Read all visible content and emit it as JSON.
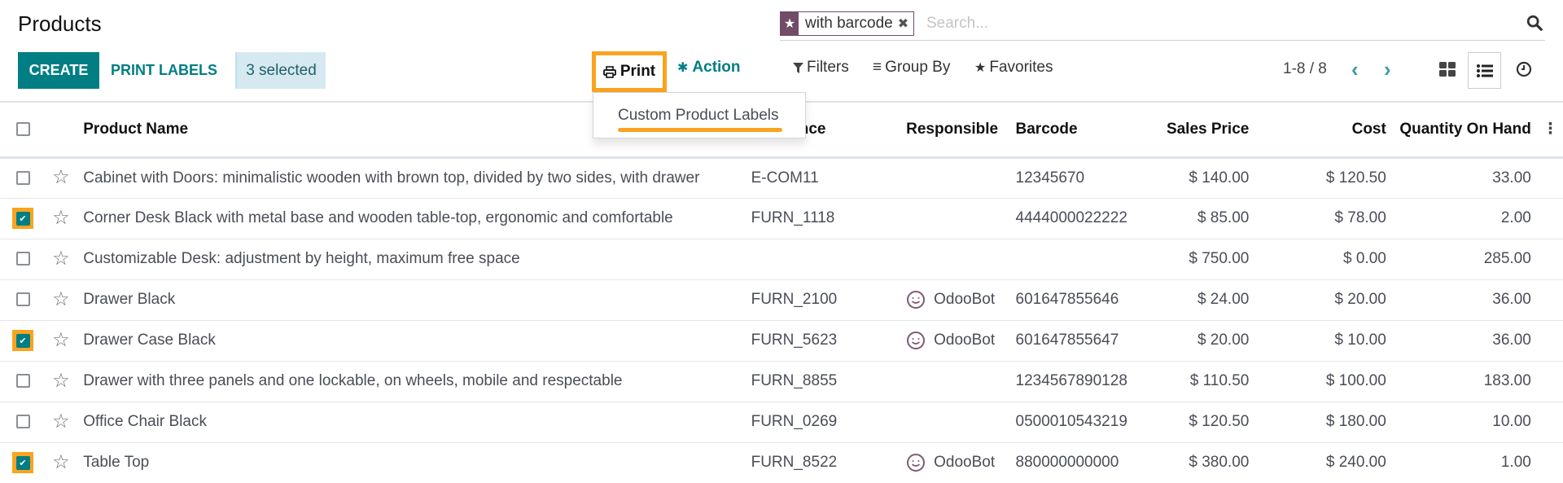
{
  "page": {
    "title": "Products"
  },
  "toolbar": {
    "create_label": "CREATE",
    "print_labels_label": "PRINT LABELS",
    "selected_label": "3 selected",
    "print_label": "Print",
    "action_label": "Action",
    "filters_label": "Filters",
    "group_by_label": "Group By",
    "favorites_label": "Favorites"
  },
  "search": {
    "facet_label": "with barcode",
    "placeholder": "Search...",
    "facet_color": "#714b67"
  },
  "pager": {
    "text": "1-8 / 8"
  },
  "print_dropdown": {
    "items": [
      {
        "label": "Custom Product Labels"
      }
    ]
  },
  "colors": {
    "brand": "#017e84",
    "highlight": "#f9a31f"
  },
  "table": {
    "columns": {
      "product_name": "Product Name",
      "reference": "Reference",
      "responsible": "Responsible",
      "barcode": "Barcode",
      "sales_price": "Sales Price",
      "cost": "Cost",
      "qty": "Quantity On Hand"
    },
    "rows": [
      {
        "selected": false,
        "name": "Cabinet with Doors: minimalistic wooden with brown top, divided by two sides, with drawer",
        "reference": "E-COM11",
        "responsible": "",
        "barcode": "12345670",
        "sales_price": "$ 140.00",
        "cost": "$ 120.50",
        "qty": "33.00"
      },
      {
        "selected": true,
        "name": "Corner Desk Black with metal base and wooden table-top, ergonomic and comfortable",
        "reference": "FURN_1118",
        "responsible": "",
        "barcode": "4444000022222",
        "sales_price": "$ 85.00",
        "cost": "$ 78.00",
        "qty": "2.00"
      },
      {
        "selected": false,
        "name": "Customizable Desk: adjustment by height, maximum free space",
        "reference": "",
        "responsible": "",
        "barcode": "",
        "sales_price": "$ 750.00",
        "cost": "$ 0.00",
        "qty": "285.00"
      },
      {
        "selected": false,
        "name": "Drawer Black",
        "reference": "FURN_2100",
        "responsible": "OdooBot",
        "barcode": "601647855646",
        "sales_price": "$ 24.00",
        "cost": "$ 20.00",
        "qty": "36.00"
      },
      {
        "selected": true,
        "name": "Drawer Case Black",
        "reference": "FURN_5623",
        "responsible": "OdooBot",
        "barcode": "601647855647",
        "sales_price": "$ 20.00",
        "cost": "$ 10.00",
        "qty": "36.00"
      },
      {
        "selected": false,
        "name": "Drawer with three panels and one lockable, on wheels, mobile and respectable",
        "reference": "FURN_8855",
        "responsible": "",
        "barcode": "1234567890128",
        "sales_price": "$ 110.50",
        "cost": "$ 100.00",
        "qty": "183.00"
      },
      {
        "selected": false,
        "name": "Office Chair Black",
        "reference": "FURN_0269",
        "responsible": "",
        "barcode": "0500010543219",
        "sales_price": "$ 120.50",
        "cost": "$ 180.00",
        "qty": "10.00"
      },
      {
        "selected": true,
        "name": "Table Top",
        "reference": "FURN_8522",
        "responsible": "OdooBot",
        "barcode": "880000000000",
        "sales_price": "$ 380.00",
        "cost": "$ 240.00",
        "qty": "1.00"
      }
    ]
  }
}
